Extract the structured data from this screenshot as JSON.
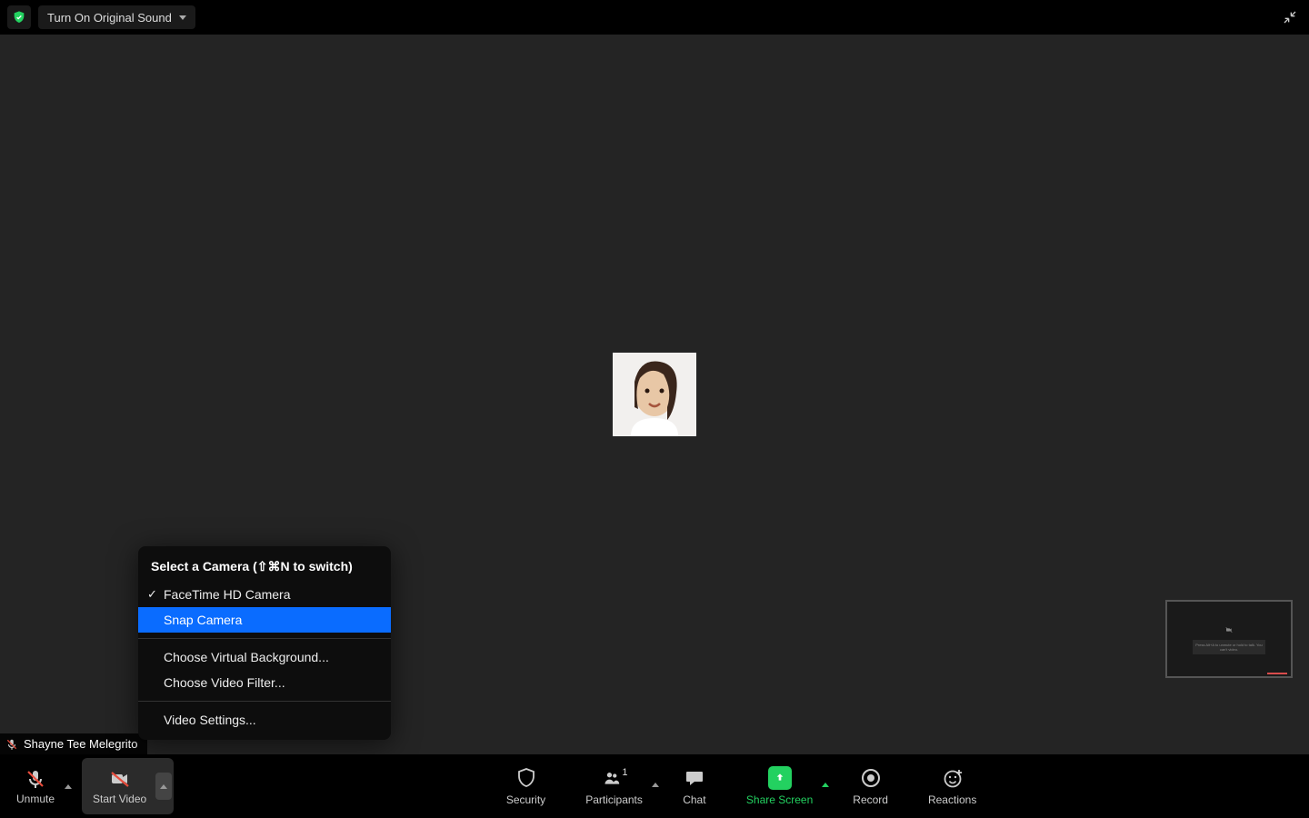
{
  "topbar": {
    "original_sound_label": "Turn On Original Sound"
  },
  "participant_name": "Shayne Tee Melegrito",
  "video_menu": {
    "header": "Select a Camera (⇧⌘N to switch)",
    "cameras": [
      {
        "label": "FaceTime HD Camera",
        "selected": true,
        "highlight": false
      },
      {
        "label": "Snap Camera",
        "selected": false,
        "highlight": true
      }
    ],
    "options_a": [
      "Choose Virtual Background...",
      "Choose Video Filter..."
    ],
    "options_b": [
      "Video Settings..."
    ]
  },
  "toolbar": {
    "unmute": "Unmute",
    "start_video": "Start Video",
    "security": "Security",
    "participants": "Participants",
    "participants_count": "1",
    "chat": "Chat",
    "share_screen": "Share Screen",
    "record": "Record",
    "reactions": "Reactions"
  },
  "selfview_hint": "Press Alt+A to unmute or hold to talk. You can't video."
}
